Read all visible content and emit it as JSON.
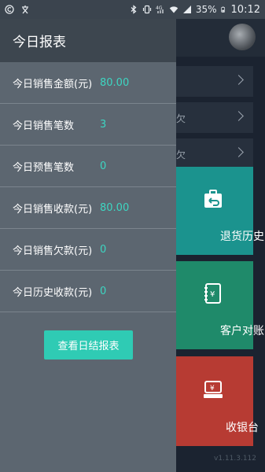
{
  "status_bar": {
    "left_icons": [
      "circle-c-icon",
      "wenzi-icon"
    ],
    "right_icons": [
      "bluetooth-icon",
      "vibrate-icon",
      "signal-4g-icon",
      "wifi-icon",
      "signal-icon"
    ],
    "battery": "35%",
    "time": "10:12"
  },
  "background": {
    "avatar_icon": "car-avatar-icon",
    "rows": [
      {
        "fragment": ""
      },
      {
        "fragment": "欠"
      },
      {
        "fragment": "欠"
      }
    ],
    "tiles": [
      {
        "label": "退货历史",
        "icon": "return-bag-icon",
        "color": "#1b938e"
      },
      {
        "label": "客户对账",
        "icon": "ledger-icon",
        "color": "#1f8a6a"
      },
      {
        "label": "收银台",
        "icon": "cashier-icon",
        "color": "#b73b33"
      }
    ],
    "version": "v1.11.3.112"
  },
  "drawer": {
    "title": "今日报表",
    "rows": [
      {
        "label": "今日销售金额(元)",
        "value": "80.00"
      },
      {
        "label": "今日销售笔数",
        "value": "3"
      },
      {
        "label": "今日预售笔数",
        "value": "0"
      },
      {
        "label": "今日销售收款(元)",
        "value": "80.00"
      },
      {
        "label": "今日销售欠款(元)",
        "value": "0"
      },
      {
        "label": "今日历史收款(元)",
        "value": "0"
      }
    ],
    "button_label": "查看日结报表",
    "accent": "#3dd6c2",
    "button_color": "#2fcbb4"
  }
}
